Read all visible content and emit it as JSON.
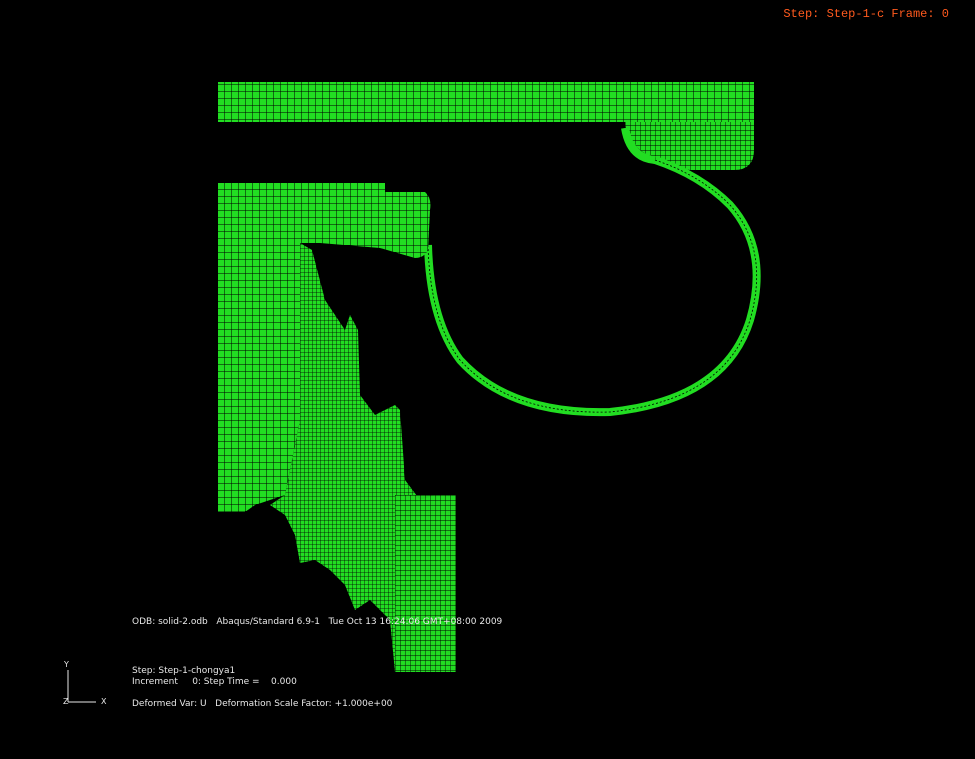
{
  "viewport_title": "Step: Step-1-c Frame: 0",
  "info_block": {
    "odb_line": "ODB: solid-2.odb   Abaqus/Standard 6.9-1   Tue Oct 13 16:24:06 GMT+08:00 2009",
    "step_line": "Step: Step-1-chongya1",
    "increment_line": "Increment     0: Step Time =    0.000",
    "deformed_line": "Deformed Var: U   Deformation Scale Factor: +1.000e+00"
  },
  "triad": {
    "y_label": "Y",
    "z_label": "Z",
    "x_label": "X"
  },
  "colors": {
    "mesh_fill": "#22dd22",
    "mesh_lines": "#000000",
    "background": "#000000",
    "title": "#ff5a1e"
  }
}
